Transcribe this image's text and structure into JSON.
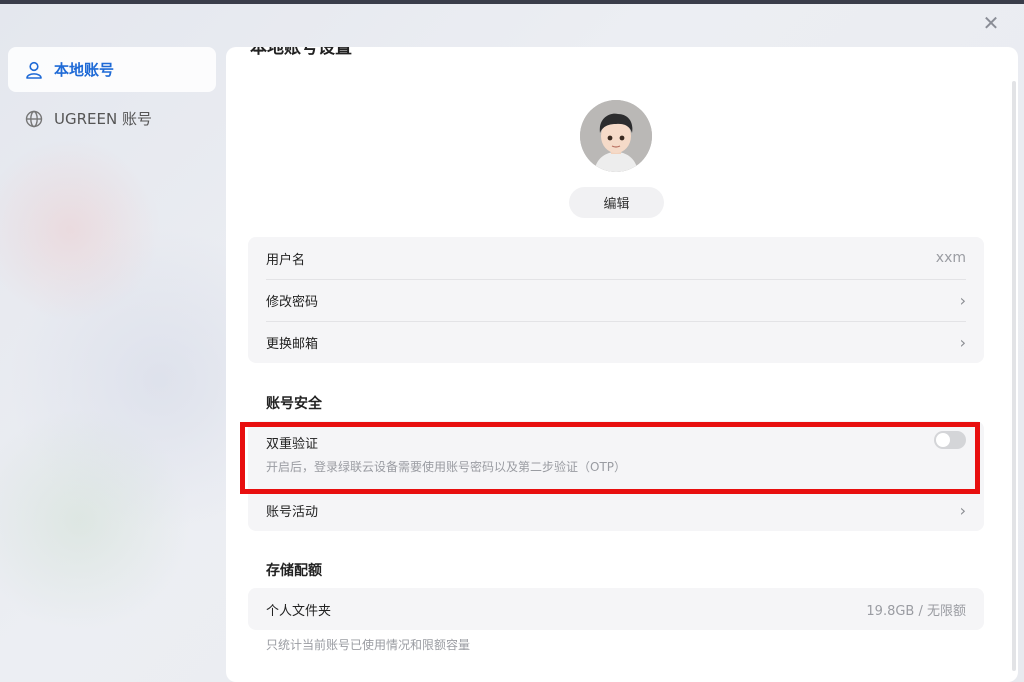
{
  "sidebar": {
    "items": [
      {
        "label": "本地账号",
        "icon": "user-icon",
        "active": true
      },
      {
        "label": "UGREEN 账号",
        "icon": "globe-icon",
        "active": false
      }
    ]
  },
  "panel": {
    "title": "本地账号设置",
    "edit_label": "编辑",
    "basic": [
      {
        "label": "用户名",
        "value": "xxm"
      },
      {
        "label": "修改密码",
        "icon": "chevron-right-icon"
      },
      {
        "label": "更换邮箱",
        "icon": "chevron-right-icon"
      }
    ],
    "security": {
      "title": "账号安全",
      "twofa_label": "双重验证",
      "twofa_desc": "开启后，登录绿联云设备需要使用账号密码以及第二步验证（OTP）",
      "twofa_enabled": false,
      "activity_label": "账号活动"
    },
    "storage": {
      "title": "存储配额",
      "folder_label": "个人文件夹",
      "folder_value": "19.8GB / 无限额",
      "note": "只统计当前账号已使用情况和限额容量"
    }
  },
  "colors": {
    "accent": "#1f6ad6",
    "highlight": "#e80f0f"
  }
}
